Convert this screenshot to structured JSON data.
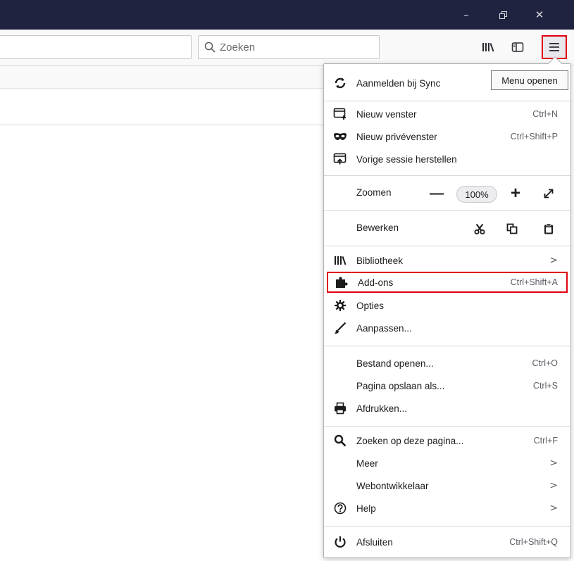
{
  "window": {
    "minimize_label": "–",
    "close_label": "✕"
  },
  "toolbar": {
    "search_placeholder": "Zoeken",
    "icons": [
      "library-icon",
      "sidebar-icon",
      "hamburger-menu-icon"
    ]
  },
  "tooltip": "Menu openen",
  "menu": {
    "sync": "Aanmelden bij Sync",
    "new_window": {
      "label": "Nieuw venster",
      "shortcut": "Ctrl+N"
    },
    "private_window": {
      "label": "Nieuw privévenster",
      "shortcut": "Ctrl+Shift+P"
    },
    "restore_session": {
      "label": "Vorige sessie herstellen"
    },
    "zoom": {
      "label": "Zoomen",
      "minus": "—",
      "value": "100%",
      "plus": "+"
    },
    "edit": {
      "label": "Bewerken"
    },
    "library": {
      "label": "Bibliotheek",
      "chevron": ">"
    },
    "addons": {
      "label": "Add-ons",
      "shortcut": "Ctrl+Shift+A"
    },
    "options": {
      "label": "Opties"
    },
    "customize": {
      "label": "Aanpassen..."
    },
    "open_file": {
      "label": "Bestand openen...",
      "shortcut": "Ctrl+O"
    },
    "save_page": {
      "label": "Pagina opslaan als...",
      "shortcut": "Ctrl+S"
    },
    "print": {
      "label": "Afdrukken..."
    },
    "find": {
      "label": "Zoeken op deze pagina...",
      "shortcut": "Ctrl+F"
    },
    "more": {
      "label": "Meer",
      "chevron": ">"
    },
    "webdev": {
      "label": "Webontwikkelaar",
      "chevron": ">"
    },
    "help": {
      "label": "Help",
      "chevron": ">"
    },
    "quit": {
      "label": "Afsluiten",
      "shortcut": "Ctrl+Shift+Q"
    }
  },
  "colors": {
    "titlebar": "#202340",
    "highlight_border": "#e0000f"
  }
}
